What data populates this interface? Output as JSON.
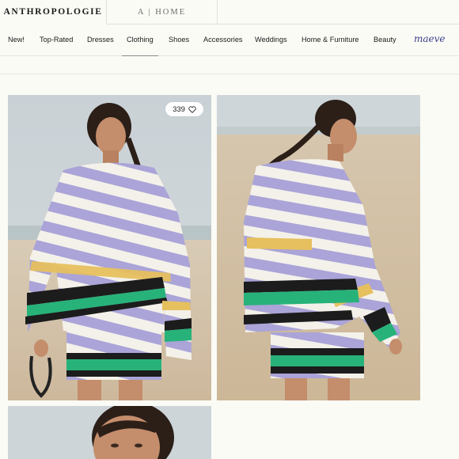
{
  "brand": {
    "main": "ANTHROPOLOGIE",
    "home": "A | HOME"
  },
  "nav": {
    "items": [
      "New!",
      "Top-Rated",
      "Dresses",
      "Clothing",
      "Shoes",
      "Accessories",
      "Weddings",
      "Home & Furniture",
      "Beauty"
    ],
    "active": "Clothing",
    "logo": "maeve"
  },
  "gallery": {
    "likes_count": "339",
    "icons": [
      "heart-icon"
    ]
  },
  "colors": {
    "background": "#fbfbf6",
    "stripe_lavender": "#a9a3d6",
    "stripe_yellow": "#e8c25f",
    "stripe_green": "#27b27a",
    "stripe_black": "#1c1c1c",
    "stripe_cream": "#f4f1ea",
    "sand": "#d9c9b3",
    "sky": "#cfd6da",
    "logo": "#3a3f8a"
  }
}
